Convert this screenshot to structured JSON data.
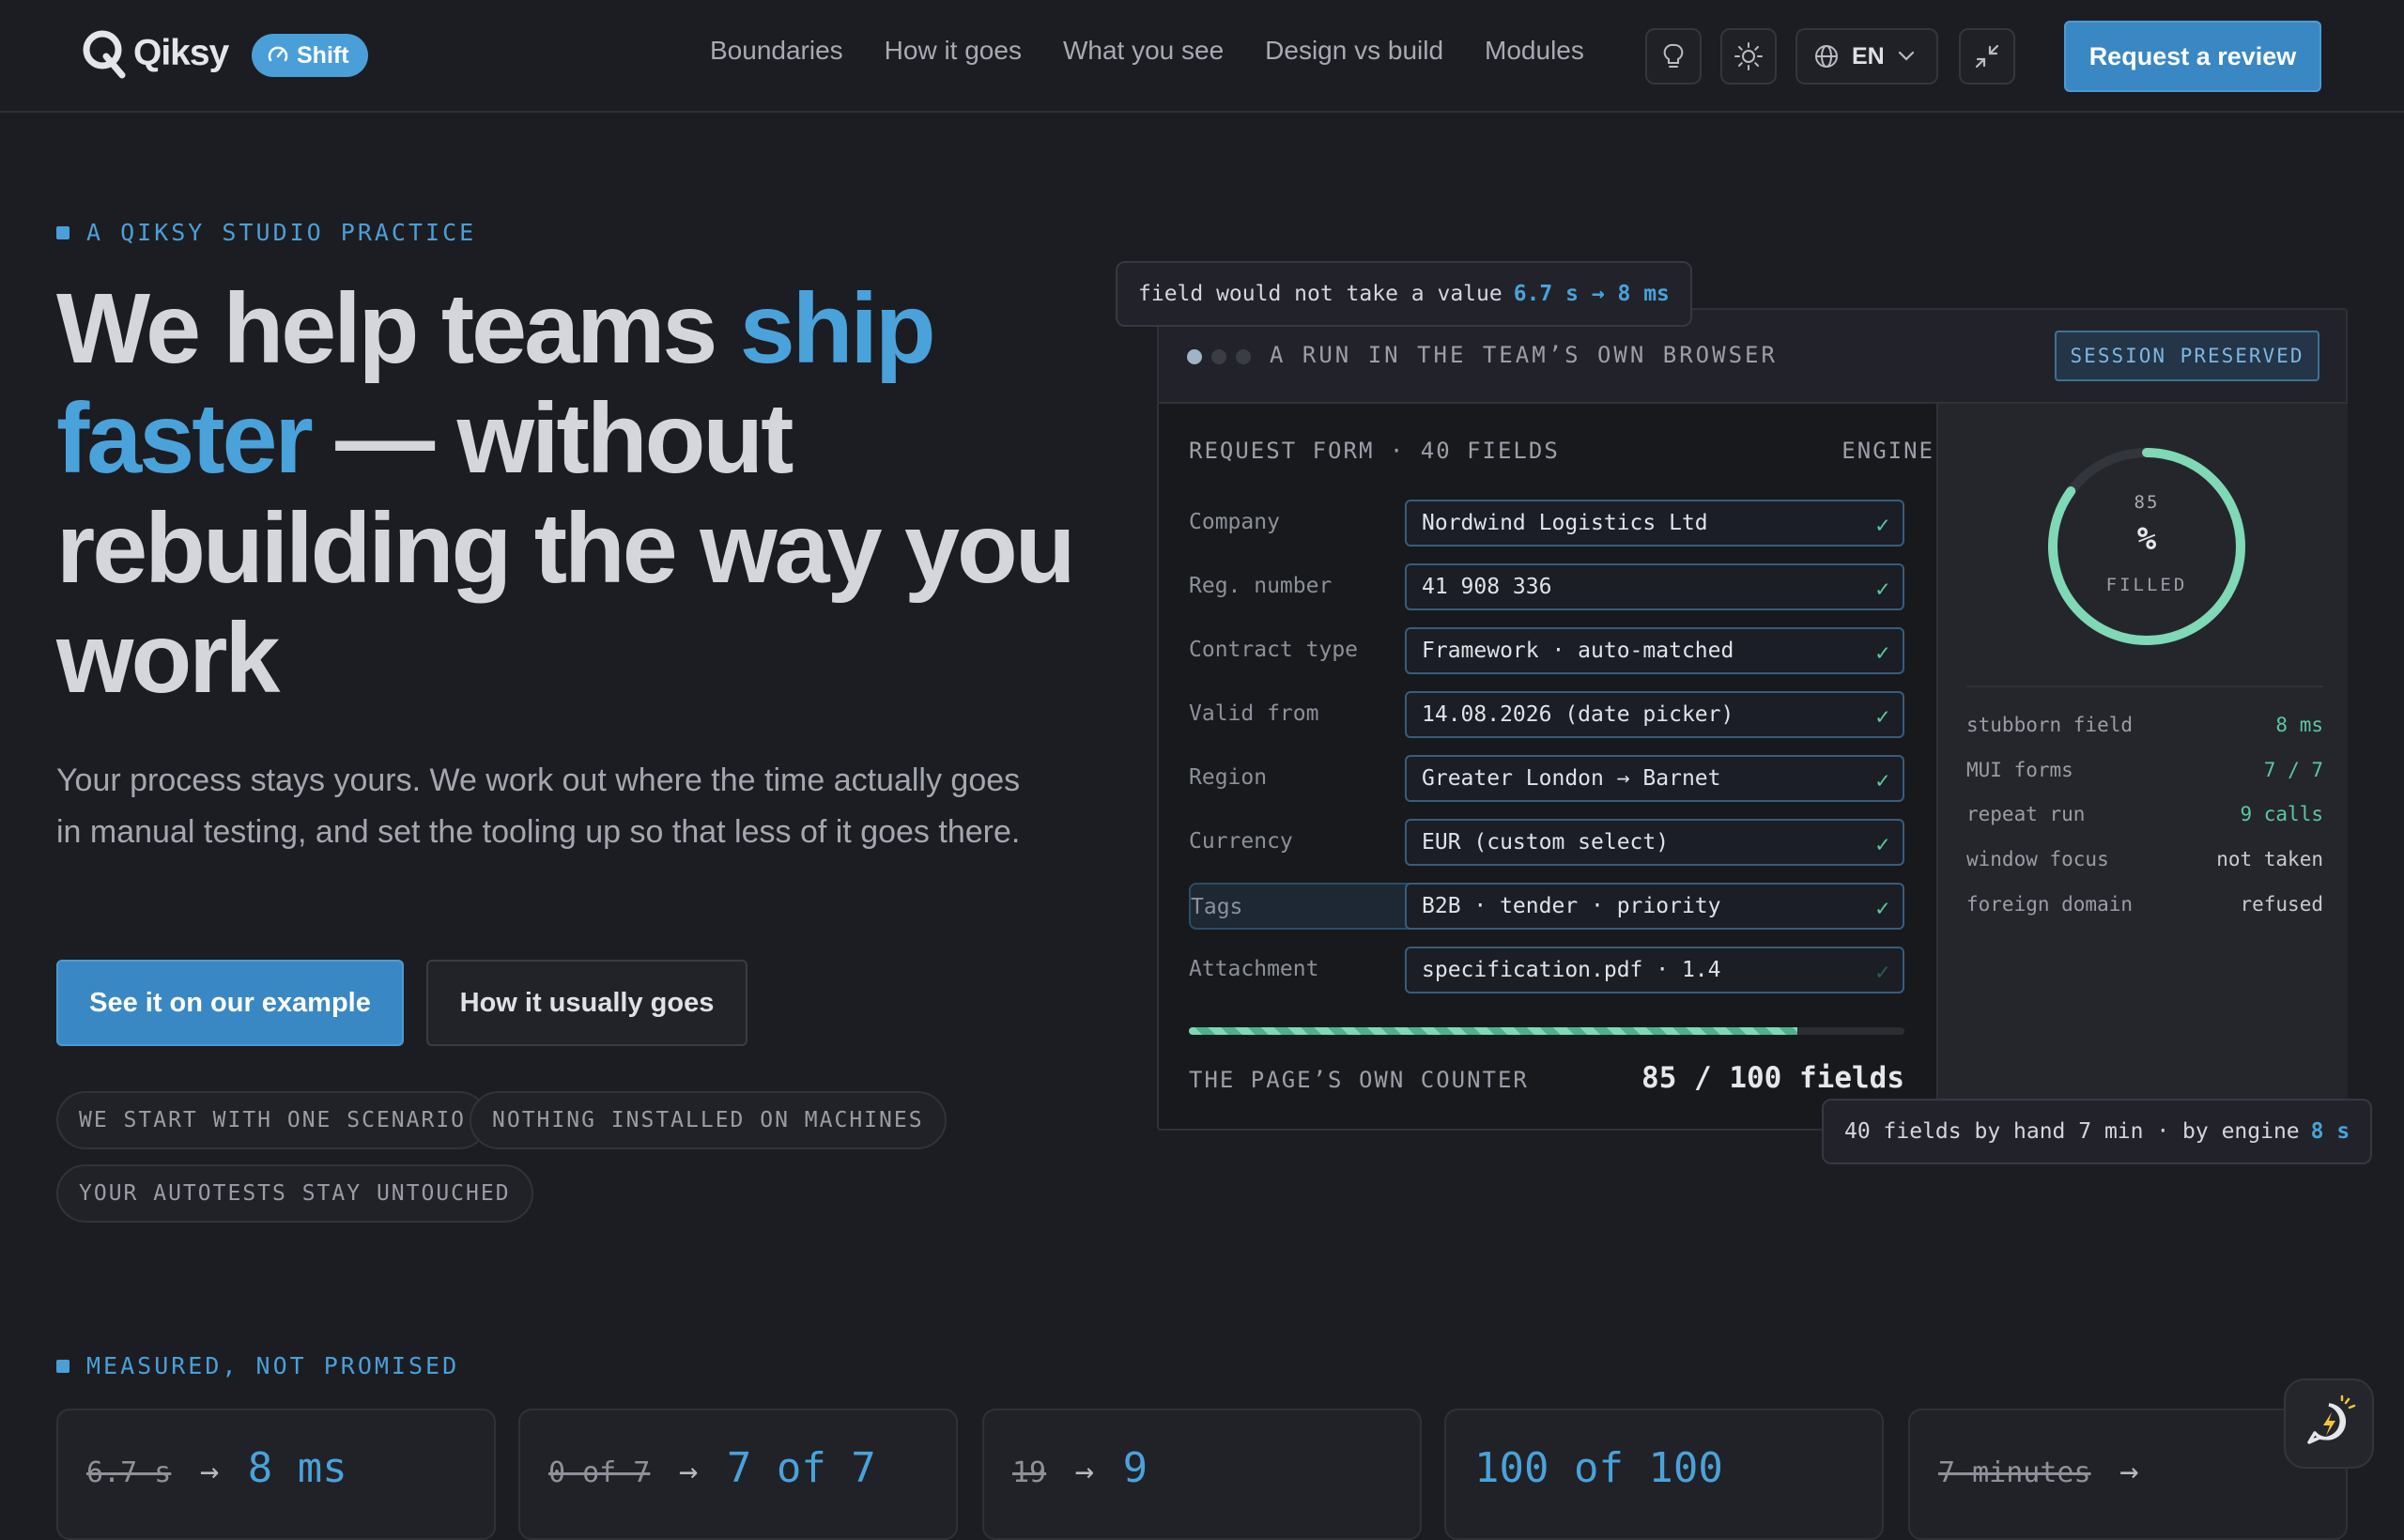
{
  "header": {
    "logo_text": "Qiksy",
    "badge_label": "Shift",
    "nav": [
      "Boundaries",
      "How it goes",
      "What you see",
      "Design vs build",
      "Modules"
    ],
    "language": "EN",
    "cta_label": "Request a review"
  },
  "hero": {
    "eyebrow": "A QIKSY STUDIO PRACTICE",
    "title_part1": "We help teams ",
    "title_accent": "ship faster",
    "title_part2": " — without rebuilding the way you work",
    "subtitle": "Your process stays yours. We work out where the time actually goes in manual testing, and set the tooling up so that less of it goes there.",
    "primary_button": "See it on our example",
    "secondary_button": "How it usually goes",
    "pills": [
      "WE START WITH ONE SCENARIO",
      "NOTHING INSTALLED ON MACHINES",
      "YOUR AUTOTESTS STAY UNTOUCHED"
    ]
  },
  "demo": {
    "tooltip_top_text": "field would not take a value",
    "tooltip_top_highlight": "6.7 s → 8 ms",
    "panel_title": "A RUN IN THE TEAM’S OWN BROWSER",
    "session_badge": "SESSION PRESERVED",
    "form_title": "REQUEST FORM · 40 FIELDS",
    "form_engine": "ENGINE",
    "fields": [
      {
        "label": "Company",
        "value": "Nordwind Logistics Ltd"
      },
      {
        "label": "Reg. number",
        "value": "41 908 336"
      },
      {
        "label": "Contract type",
        "value": "Framework · auto-matched"
      },
      {
        "label": "Valid from",
        "value": "14.08.2026 (date picker)"
      },
      {
        "label": "Region",
        "value": "Greater London → Barnet"
      },
      {
        "label": "Currency",
        "value": "EUR (custom select)"
      },
      {
        "label": "Tags",
        "value": "B2B · tender · priority"
      },
      {
        "label": "Attachment",
        "value": "specification.pdf · 1.4"
      }
    ],
    "check_glyph": "✓",
    "progress": 0.85,
    "counter_label": "THE PAGE’S OWN COUNTER",
    "counter_value": "85 / 100 fields",
    "gauge": {
      "number": "85",
      "unit": "%",
      "label": "FILLED",
      "fraction": 0.85
    },
    "stats": [
      {
        "key": "stubborn field",
        "value": "8 ms",
        "green": true
      },
      {
        "key": "MUI forms",
        "value": "7 / 7",
        "green": true
      },
      {
        "key": "repeat run",
        "value": "9 calls",
        "green": true
      },
      {
        "key": "window focus",
        "value": "not taken",
        "green": false
      },
      {
        "key": "foreign domain",
        "value": "refused",
        "green": false
      }
    ],
    "tooltip_bottom_text": "40 fields by hand 7 min · by engine",
    "tooltip_bottom_highlight": "8 s"
  },
  "measured": {
    "eyebrow": "MEASURED, NOT PROMISED",
    "cards": [
      {
        "old": "6.7 s",
        "new": "8 ms"
      },
      {
        "old": "0 of 7",
        "new": "7 of 7"
      },
      {
        "old": "19",
        "new": "9"
      },
      {
        "old": "",
        "new": "100 of 100"
      },
      {
        "old": "7 minutes",
        "new": ""
      }
    ],
    "arrow": "→"
  },
  "colors": {
    "accent": "#4aa2da",
    "success": "#5bc8a0",
    "background": "#1c1d22"
  },
  "icons": [
    "qiksy-logo-icon",
    "gauge-icon",
    "lightbulb-icon",
    "sun-icon",
    "globe-icon",
    "chevron-down-icon",
    "collapse-icon",
    "chat-bolt-icon"
  ]
}
